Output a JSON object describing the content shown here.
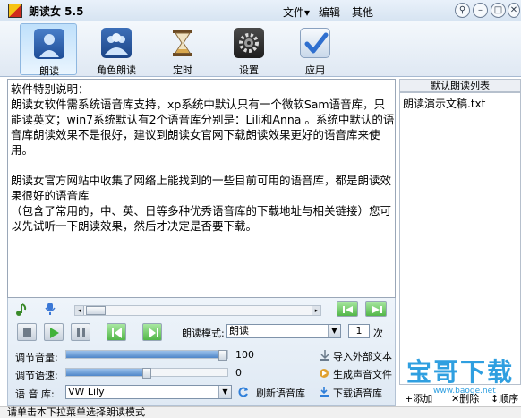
{
  "window": {
    "title": "朗读女 5.5",
    "menu": [
      "文件▾",
      "编辑",
      "其他"
    ],
    "controls": [
      "pin-icon",
      "minimize-icon",
      "maximize-icon",
      "close-icon"
    ]
  },
  "toolbar": {
    "items": [
      {
        "label": "朗读",
        "icon": "person-icon",
        "active": true
      },
      {
        "label": "角色朗读",
        "icon": "group-icon",
        "active": false
      },
      {
        "label": "定时",
        "icon": "hourglass-icon",
        "active": false
      },
      {
        "label": "设置",
        "icon": "gear-icon",
        "active": false
      },
      {
        "label": "应用",
        "icon": "checkmark-icon",
        "active": false
      }
    ]
  },
  "editor": {
    "text": "软件特别说明：\n朗读女软件需系统语音库支持，xp系统中默认只有一个微软Sam语音库，只能读英文；win7系统默认有2个语音库分别是：Lili和Anna 。系统中默认的语音库朗读效果不是很好，建议到朗读女官网下载朗读效果更好的语音库来使用。\n\n朗读女官方网站中收集了网络上能找到的一些目前可用的语音库，都是朗读效果很好的语音库\n（包含了常用的，中、英、日等多种优秀语音库的下载地址与相关链接）您可以先试听一下朗读效果，然后才决定是否要下载。"
  },
  "playlist": {
    "header": "默认朗读列表",
    "items": [
      "朗读演示文稿.txt"
    ]
  },
  "controls": {
    "progress": 0.0,
    "read_mode_label": "朗读模式:",
    "read_mode_value": "朗读",
    "repeat_value": "1",
    "repeat_unit": "次",
    "volume_label": "调节音量:",
    "volume_value": "100",
    "volume_level": 1.0,
    "speed_label": "调节语速:",
    "speed_value": "0",
    "speed_level": 0.5,
    "voice_label": "语 音 库:",
    "voice_value": "VW Lily",
    "refresh_label": "刷新语音库",
    "import_label": "导入外部文本",
    "generate_label": "生成声音文件",
    "download_label": "下载语音库"
  },
  "list_actions": [
    "+添加",
    "✕删除",
    "↕顺序"
  ],
  "watermark": {
    "text": "宝哥下载",
    "url": "www.baoge.net"
  },
  "status": {
    "text": "请单击本下拉菜单选择朗读模式"
  }
}
